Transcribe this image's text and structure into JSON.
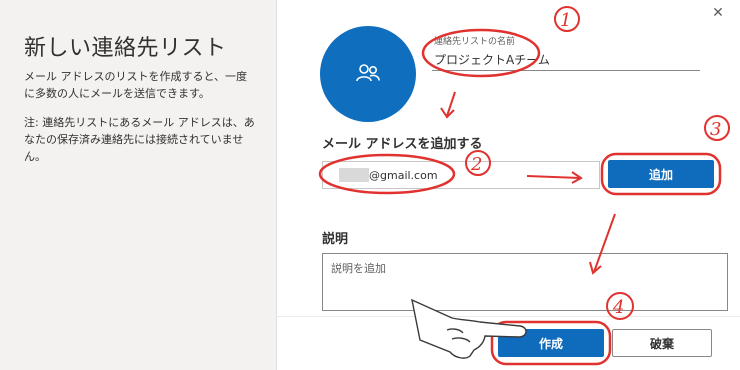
{
  "left_panel": {
    "title": "新しい連絡先リスト",
    "description": "メール アドレスのリストを作成すると、一度に多数の人にメールを送信できます。",
    "note": "注: 連絡先リストにあるメール アドレスは、あなたの保存済み連絡先には接続されていません。"
  },
  "close_icon": "close-icon",
  "avatar_icon": "people-icon",
  "list_name": {
    "label": "連絡先リストの名前",
    "value": "プロジェクトAチーム"
  },
  "email": {
    "heading": "メール アドレスを追加する",
    "value": "@gmail.com",
    "add_label": "追加"
  },
  "description": {
    "heading": "説明",
    "placeholder": "説明を追加"
  },
  "footer": {
    "create_label": "作成",
    "discard_label": "破棄"
  },
  "annotations": {
    "step1": "1",
    "step2": "2",
    "step3": "3",
    "step4": "4"
  },
  "colors": {
    "accent": "#0f6cbd",
    "avatar": "#106ebe",
    "annotation": "#e0322f",
    "left_bg": "#f3f2f1"
  }
}
